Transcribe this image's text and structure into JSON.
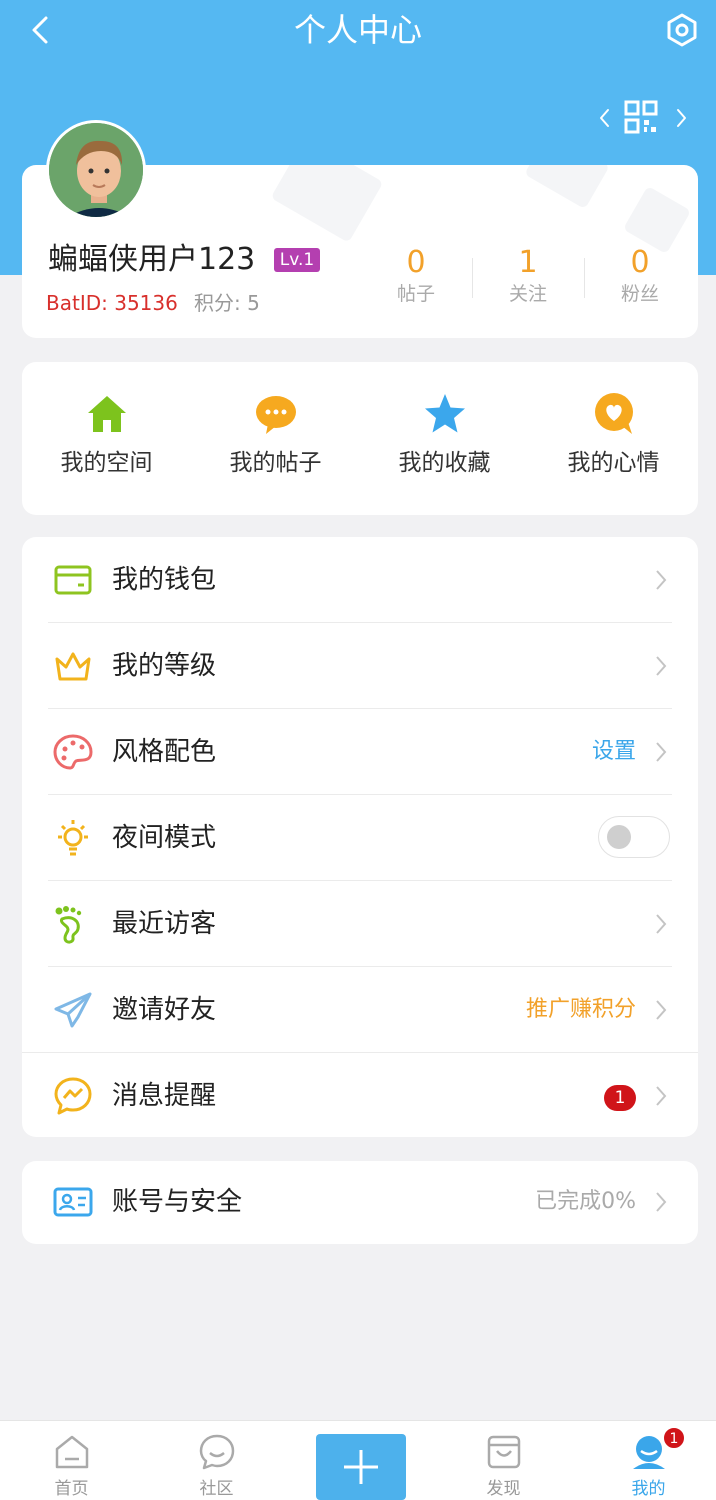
{
  "colors": {
    "header": "#55b8f2",
    "accent": "#3aa6ea",
    "orange": "#f2a12a",
    "red": "#d8302c",
    "level_badge": "#b43fb0",
    "background": "#f1f1f3"
  },
  "header": {
    "title": "个人中心",
    "back_icon": "chevron-left-icon",
    "settings_icon": "settings-hexagon-icon",
    "qr_icon": "qr-code-icon"
  },
  "profile": {
    "username": "蝙蝠侠用户123",
    "level": "Lv.1",
    "batid": "BatID: 35136",
    "points": "积分: 5",
    "stats": [
      {
        "value": "0",
        "label": "帖子"
      },
      {
        "value": "1",
        "label": "关注"
      },
      {
        "value": "0",
        "label": "粉丝"
      }
    ]
  },
  "quick_actions": [
    {
      "label": "我的空间",
      "icon": "home-icon"
    },
    {
      "label": "我的帖子",
      "icon": "chat-bubble-icon"
    },
    {
      "label": "我的收藏",
      "icon": "star-icon"
    },
    {
      "label": "我的心情",
      "icon": "heart-bubble-icon"
    }
  ],
  "menu": [
    {
      "label": "我的钱包",
      "icon": "wallet-icon"
    },
    {
      "label": "我的等级",
      "icon": "crown-icon"
    },
    {
      "label": "风格配色",
      "icon": "palette-icon",
      "value": "设置"
    },
    {
      "label": "夜间模式",
      "icon": "lightbulb-icon",
      "toggle_on": false
    },
    {
      "label": "最近访客",
      "icon": "footprint-icon"
    },
    {
      "label": "邀请好友",
      "icon": "paper-plane-icon",
      "value": "推广赚积分"
    },
    {
      "label": "消息提醒",
      "icon": "message-icon",
      "badge": "1"
    }
  ],
  "account": {
    "label": "账号与安全",
    "icon": "id-card-icon",
    "value": "已完成0%"
  },
  "tabbar": {
    "tabs": [
      {
        "label": "首页",
        "icon": "home-outline-icon"
      },
      {
        "label": "社区",
        "icon": "chat-outline-icon"
      },
      {
        "label": "",
        "icon": "plus-icon"
      },
      {
        "label": "发现",
        "icon": "shopping-bag-icon"
      },
      {
        "label": "我的",
        "icon": "profile-icon",
        "badge": "1"
      }
    ],
    "active_index": 4
  }
}
